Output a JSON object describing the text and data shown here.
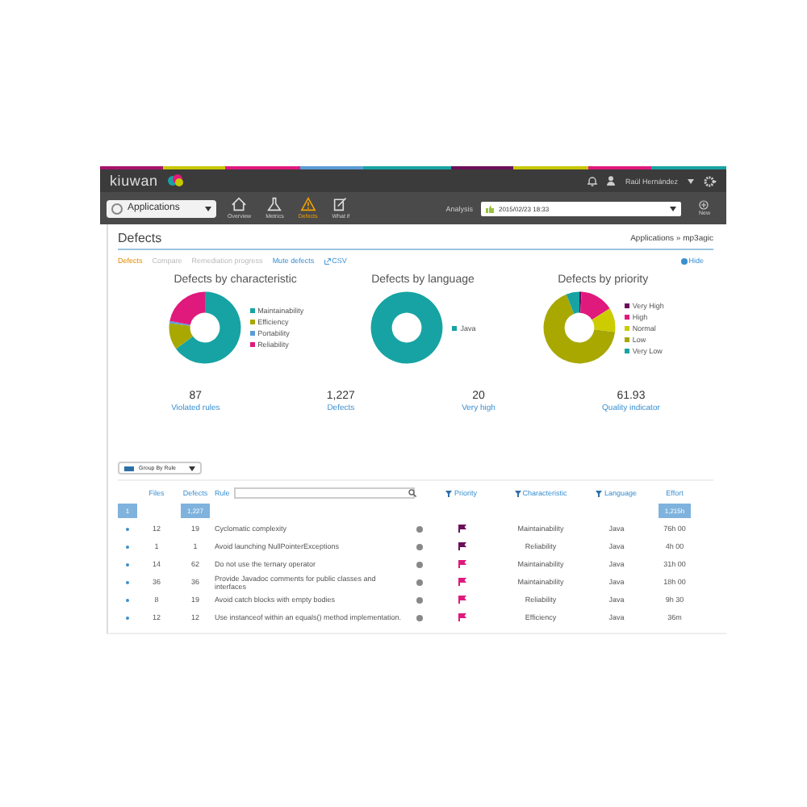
{
  "header": {
    "logo": "kiuwan",
    "user": "Raúl Hernández"
  },
  "toolbar": {
    "app_selector": "Applications",
    "nav": [
      {
        "label": "Overview",
        "kind": "house",
        "selected": false
      },
      {
        "label": "Metrics",
        "kind": "flask",
        "selected": false
      },
      {
        "label": "Defects",
        "kind": "warning",
        "selected": true
      },
      {
        "label": "What if",
        "kind": "edit",
        "selected": false
      }
    ],
    "analysis_label": "Analysis",
    "analysis_value": "2015/02/23 18:33",
    "new_label": "New"
  },
  "page": {
    "title": "Defects",
    "breadcrumb": "Applications » mp3agic"
  },
  "tabs": [
    {
      "label": "Defects",
      "kind": "tab",
      "selected": true
    },
    {
      "label": "Compare",
      "kind": "tab",
      "selected": false
    },
    {
      "label": "Remediation progress",
      "kind": "tab",
      "selected": false
    },
    {
      "label": "Mute defects",
      "kind": "link"
    },
    {
      "label": "CSV",
      "kind": "export"
    }
  ],
  "hide": "Hide",
  "charts": [
    {
      "title": "Defects by characteristic",
      "legend": [
        {
          "label": "Maintainability",
          "color": "#17a3a3"
        },
        {
          "label": "Efficiency",
          "color": "#a8a800"
        },
        {
          "label": "Portability",
          "color": "#5b9bd5"
        },
        {
          "label": "Reliability",
          "color": "#e0197d"
        }
      ]
    },
    {
      "title": "Defects by language",
      "legend": [
        {
          "label": "Java",
          "color": "#17a3a3"
        }
      ]
    },
    {
      "title": "Defects by priority",
      "legend": [
        {
          "label": "Very High",
          "color": "#6b0f5a"
        },
        {
          "label": "High",
          "color": "#e0197d"
        },
        {
          "label": "Normal",
          "color": "#cccc00"
        },
        {
          "label": "Low",
          "color": "#a8a800"
        },
        {
          "label": "Very Low",
          "color": "#17a3a3"
        }
      ]
    }
  ],
  "stats": [
    {
      "value": "87",
      "label": "Violated rules"
    },
    {
      "value": "1,227",
      "label": "Defects"
    },
    {
      "value": "20",
      "label": "Very high"
    },
    {
      "value": "61.93",
      "label": "Quality indicator"
    }
  ],
  "group_by": "Group By Rule",
  "table": {
    "columns": [
      {
        "label": "Files",
        "kind": "plain"
      },
      {
        "label": "Defects",
        "kind": "plain"
      },
      {
        "label": "Rule",
        "kind": "search"
      },
      {
        "label": "Priority",
        "kind": "filter"
      },
      {
        "label": "Characteristic",
        "kind": "filter"
      },
      {
        "label": "Language",
        "kind": "filter"
      },
      {
        "label": "Effort",
        "kind": "plain"
      }
    ],
    "totals": {
      "page": "1",
      "defects": "1,227",
      "effort": "1,215h"
    },
    "rows": [
      {
        "files": "12",
        "defects": "19",
        "rule": "Cyclomatic complexity",
        "color": "#6b0f5a",
        "characteristic": "Maintainability",
        "language": "Java",
        "effort": "76h 00"
      },
      {
        "files": "1",
        "defects": "1",
        "rule": "Avoid launching NullPointerExceptions",
        "color": "#6b0f5a",
        "characteristic": "Reliability",
        "language": "Java",
        "effort": "4h 00"
      },
      {
        "files": "14",
        "defects": "62",
        "rule": "Do not use the ternary operator",
        "color": "#e0197d",
        "characteristic": "Maintainability",
        "language": "Java",
        "effort": "31h 00"
      },
      {
        "files": "36",
        "defects": "36",
        "rule": "Provide Javadoc comments for public classes and interfaces",
        "color": "#e0197d",
        "characteristic": "Maintainability",
        "language": "Java",
        "effort": "18h 00"
      },
      {
        "files": "8",
        "defects": "19",
        "rule": "Avoid catch blocks with empty bodies",
        "color": "#e0197d",
        "characteristic": "Reliability",
        "language": "Java",
        "effort": "9h 30"
      },
      {
        "files": "12",
        "defects": "12",
        "rule": "Use instanceof within an equals() method implementation.",
        "color": "#e0197d",
        "characteristic": "Efficiency",
        "language": "Java",
        "effort": "36m"
      }
    ]
  }
}
